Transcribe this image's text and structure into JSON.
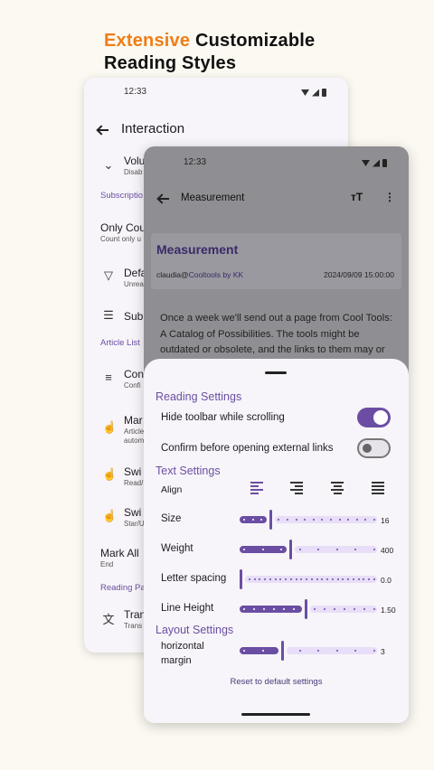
{
  "headline": {
    "accent": "Extensive",
    "rest": " Customizable",
    "line2": "Reading Styles"
  },
  "back_phone": {
    "status_time": "12:33",
    "title": "Interaction",
    "items": [
      {
        "label": "Volu",
        "sub": "Disab",
        "icon": "double-chevron-down-icon"
      },
      {
        "label": "Only Cou",
        "sub": "Count only u"
      },
      {
        "label": "Defa",
        "sub": "Unrea",
        "icon": "filter-icon"
      },
      {
        "label": "Sub",
        "sub": "",
        "icon": "sort-lines-icon"
      },
      {
        "label": "Con",
        "sub": "Confi",
        "icon": "list-check-icon"
      },
      {
        "label": "Mar",
        "sub": "Article",
        "sub2": "autom",
        "icon": "tap-gesture-icon"
      },
      {
        "label": "Swi",
        "sub": "Read/",
        "icon": "swipe-gesture-icon"
      },
      {
        "label": "Swi",
        "sub": "Star/U",
        "icon": "swipe-gesture-icon"
      },
      {
        "label": "Mark All",
        "sub": "End"
      },
      {
        "label": "Tran",
        "sub": "Trans",
        "icon": "translate-icon"
      }
    ],
    "sections": [
      "Subscriptio",
      "Article List",
      "Reading Pa"
    ]
  },
  "front_phone": {
    "status_time": "12:33",
    "appbar_title": "Measurement",
    "article_title": "Measurement",
    "author": "claudia@",
    "author_source": "Cooltools by KK",
    "date": "2024/09/09 15:00:00",
    "body": "Once a week we'll send out a page from Cool Tools: A Catalog of Possibilities. The tools might be outdated or obsolete, and the links to them may or"
  },
  "sheet": {
    "reading_settings": "Reading Settings",
    "hide_toolbar": "Hide toolbar while scrolling",
    "hide_toolbar_on": true,
    "confirm_external": "Confirm before opening external links",
    "confirm_external_on": false,
    "text_settings": "Text Settings",
    "align_label": "Align",
    "align_selected": "left",
    "size_label": "Size",
    "size_value": "16",
    "weight_label": "Weight",
    "weight_value": "400",
    "letter_spacing_label": "Letter spacing",
    "letter_spacing_value": "0.0",
    "line_height_label": "Line Height",
    "line_height_value": "1.50",
    "layout_settings": "Layout Settings",
    "horizontal_margin_label_1": "horizontal",
    "horizontal_margin_label_2": "margin",
    "horizontal_margin_value": "3",
    "reset_label": "Reset to default settings",
    "slider_levels": {
      "size": 0.22,
      "weight": 0.37,
      "letter_spacing": 0.0,
      "line_height": 0.48,
      "margin": 0.31
    }
  },
  "colors": {
    "accent": "#6b4ea3",
    "headline_accent": "#f07d16",
    "track_inactive": "#e8def8"
  }
}
